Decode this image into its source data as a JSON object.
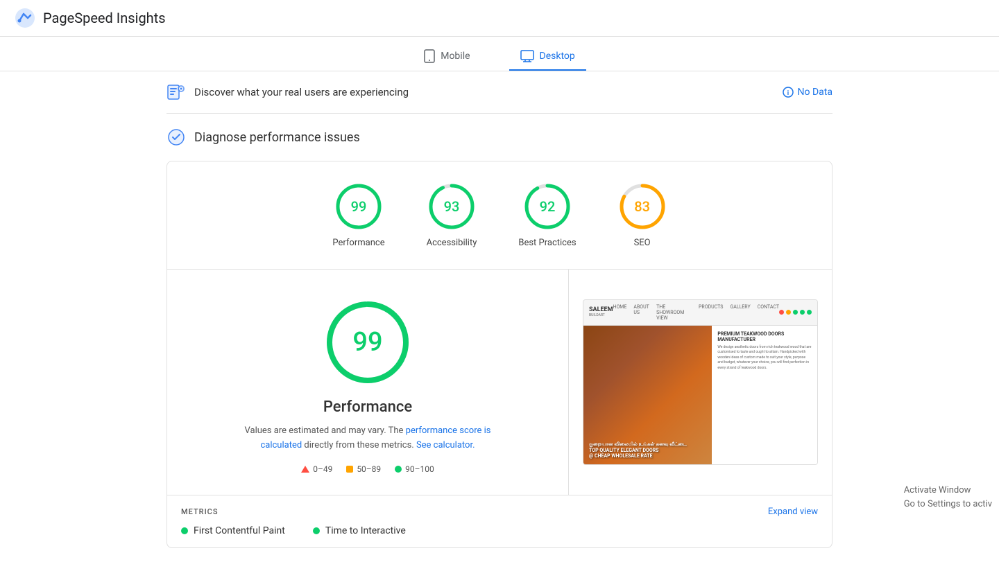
{
  "header": {
    "title": "PageSpeed Insights",
    "logo_alt": "PageSpeed Insights Logo"
  },
  "tabs": {
    "mobile": {
      "label": "Mobile",
      "active": false
    },
    "desktop": {
      "label": "Desktop",
      "active": true
    }
  },
  "discover": {
    "text": "Discover what your real users are experiencing",
    "no_data_label": "No Data"
  },
  "diagnose": {
    "title": "Diagnose performance issues"
  },
  "scores": [
    {
      "id": "performance",
      "value": 99,
      "label": "Performance",
      "color": "#0cce6b",
      "stroke_color": "#0cce6b"
    },
    {
      "id": "accessibility",
      "value": 93,
      "label": "Accessibility",
      "color": "#0cce6b",
      "stroke_color": "#0cce6b"
    },
    {
      "id": "best-practices",
      "value": 92,
      "label": "Best Practices",
      "color": "#0cce6b",
      "stroke_color": "#0cce6b"
    },
    {
      "id": "seo",
      "value": 83,
      "label": "SEO",
      "color": "#ffa400",
      "stroke_color": "#ffa400"
    }
  ],
  "performance_detail": {
    "score": 99,
    "title": "Performance",
    "desc_prefix": "Values are estimated and may vary. The ",
    "desc_link1_text": "performance score is calculated",
    "desc_middle": " directly from these metrics. ",
    "desc_link2_text": "See calculator.",
    "color": "#0cce6b"
  },
  "legend": {
    "low_label": "0–49",
    "mid_label": "50–89",
    "high_label": "90–100"
  },
  "metrics": {
    "title": "METRICS",
    "expand_label": "Expand view",
    "items": [
      {
        "label": "First Contentful Paint",
        "color": "#0cce6b"
      },
      {
        "label": "Time to Interactive",
        "color": "#0cce6b"
      }
    ]
  },
  "preview": {
    "site_name": "SALEEM",
    "site_sub": "BUILDART",
    "nav_items": [
      "HOME",
      "ABOUT US",
      "THE SHOWROOM VIEW",
      "PRODUCTS",
      "GALLERY",
      "CONTACT"
    ],
    "dots": [
      "#f00",
      "#f90",
      "#0a0",
      "#0a0",
      "#0a0"
    ],
    "headline": "PREMIUM TEAKWOOD DOORS MANUFACTURER",
    "body_text": "We design aesthetic doors from rich teakwood wood that are customised to taste and ought to attain. Handpicked with wooden ideas of custom made to suit your style, purpose and budget, whatever your choice, you will find perfection in every strand of teakwood doors.",
    "image_text_line1": "குறைவான விலையில் உங்கள் கனவு வீட்டை",
    "image_text_line2": "TOP QUALITY ELEGANT DOORS",
    "image_text_line3": "@ CHEAP WHOLESALE RATE"
  },
  "watermark": {
    "line1": "Activate Window",
    "line2": "Go to Settings to activ"
  }
}
